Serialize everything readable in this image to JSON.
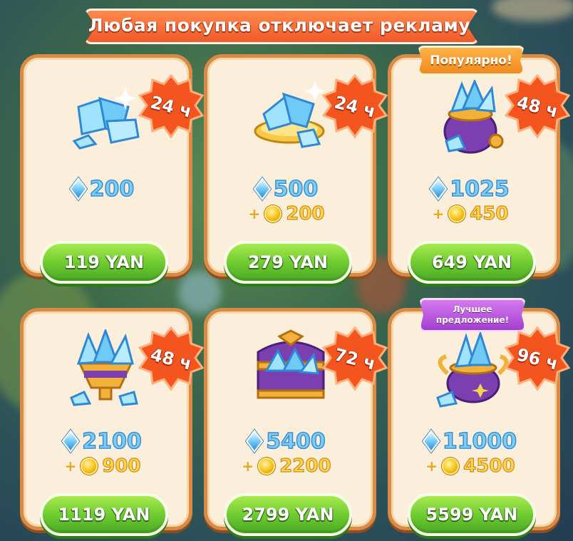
{
  "banner": {
    "text": "Любая покупка отключает рекламу"
  },
  "colors": {
    "card_fill": "#fbeedb",
    "card_border": "#d98a45",
    "button_green": "#6cc92e",
    "timer_red": "#f04a22",
    "popular_orange": "#f08a1f",
    "best_purple": "#a23fcf",
    "gem_blue": "#7ccdf7",
    "coin_gold": "#ffd34d"
  },
  "offers": [
    {
      "timer": "24 ч",
      "gems": "200",
      "coins": "",
      "price": "119 YAN",
      "ribbon": "",
      "icon": "crystal-pile-icon"
    },
    {
      "timer": "24 ч",
      "gems": "500",
      "coins": "200",
      "price": "279 YAN",
      "ribbon": "",
      "icon": "crystal-plate-icon"
    },
    {
      "timer": "48 ч",
      "gems": "1025",
      "coins": "450",
      "price": "649 YAN",
      "ribbon": "Популярно!",
      "icon": "crystal-sack-icon"
    },
    {
      "timer": "48 ч",
      "gems": "2100",
      "coins": "900",
      "price": "1119 YAN",
      "ribbon": "",
      "icon": "crystal-goblet-icon"
    },
    {
      "timer": "72 ч",
      "gems": "5400",
      "coins": "2200",
      "price": "2799 YAN",
      "ribbon": "",
      "icon": "crystal-chest-icon"
    },
    {
      "timer": "96 ч",
      "gems": "11000",
      "coins": "4500",
      "price": "5599 YAN",
      "ribbon": "Лучшее предложение!",
      "icon": "crystal-pot-icon"
    }
  ]
}
